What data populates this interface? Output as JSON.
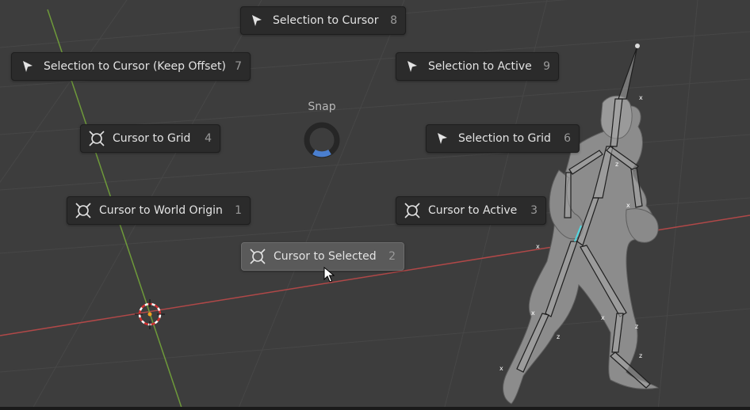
{
  "pie_menu": {
    "title": "Snap",
    "items": [
      {
        "label": "Selection to Cursor",
        "key": "8",
        "icon": "arrow-cursor-icon"
      },
      {
        "label": "Selection to Cursor (Keep Offset)",
        "key": "7",
        "icon": "arrow-cursor-icon"
      },
      {
        "label": "Selection to Active",
        "key": "9",
        "icon": "arrow-cursor-icon"
      },
      {
        "label": "Cursor to Grid",
        "key": "4",
        "icon": "3d-cursor-icon"
      },
      {
        "label": "Selection to Grid",
        "key": "6",
        "icon": "arrow-cursor-icon"
      },
      {
        "label": "Cursor to World Origin",
        "key": "1",
        "icon": "3d-cursor-icon"
      },
      {
        "label": "Cursor to Active",
        "key": "3",
        "icon": "3d-cursor-icon"
      },
      {
        "label": "Cursor to Selected",
        "key": "2",
        "icon": "3d-cursor-icon",
        "highlighted": true
      }
    ]
  },
  "colors": {
    "background": "#3d3d3d",
    "grid_line": "#4a4a4a",
    "x_axis": "#b04848",
    "y_axis": "#6e9a3a",
    "pie_direction": "#4a7fd0",
    "active_bone": "#4fd6e0",
    "menu_item": "#2b2b2b",
    "menu_item_active": "#5a5a5a"
  }
}
